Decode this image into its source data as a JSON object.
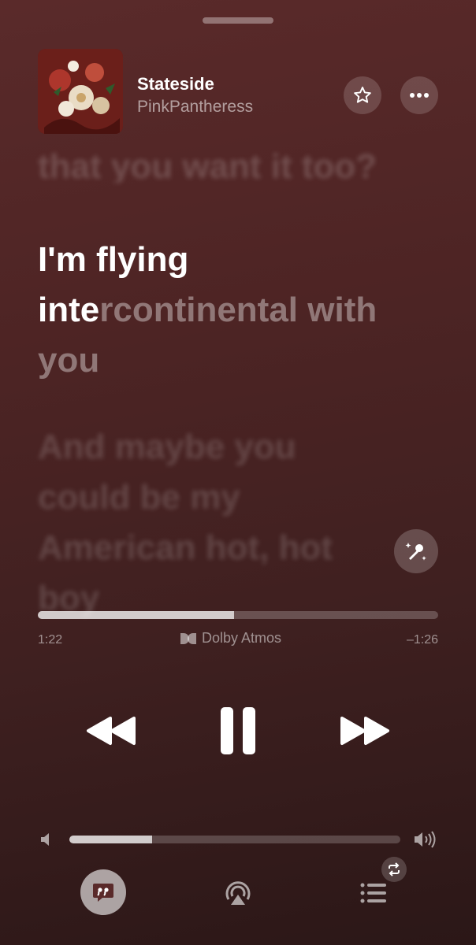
{
  "track": {
    "title": "Stateside",
    "artist": "PinkPantheress",
    "artwork_icon": "album-artwork"
  },
  "header": {
    "favorite_icon": "star-icon",
    "more_icon": "ellipsis-icon"
  },
  "lyrics": {
    "previous_line": "that you want it too?",
    "current_line_sung_1": "I'm flying",
    "current_line_sung_2": "inte",
    "current_line_unsung_2": "rcontinental with",
    "current_line_unsung_3": "you",
    "next_lines": [
      "And maybe you",
      "could be my",
      "American hot, hot",
      "boy"
    ]
  },
  "sing_button_icon": "microphone-sparkles-icon",
  "playback": {
    "elapsed": "1:22",
    "remaining": "–1:26",
    "progress_fraction": 0.49,
    "audio_format": "Dolby Atmos"
  },
  "transport": {
    "rewind_icon": "rewind-icon",
    "pause_icon": "pause-icon",
    "forward_icon": "fast-forward-icon"
  },
  "volume": {
    "level_fraction": 0.25,
    "low_icon": "speaker-low-icon",
    "high_icon": "speaker-high-icon"
  },
  "bottom_bar": {
    "lyrics_icon": "lyrics-quote-icon",
    "airplay_icon": "airplay-icon",
    "queue_icon": "queue-list-icon",
    "repeat_icon": "repeat-icon"
  },
  "colors": {
    "background_top": "#5a2a2a",
    "background_bottom": "#2b1717",
    "accent": "#ffffff"
  }
}
